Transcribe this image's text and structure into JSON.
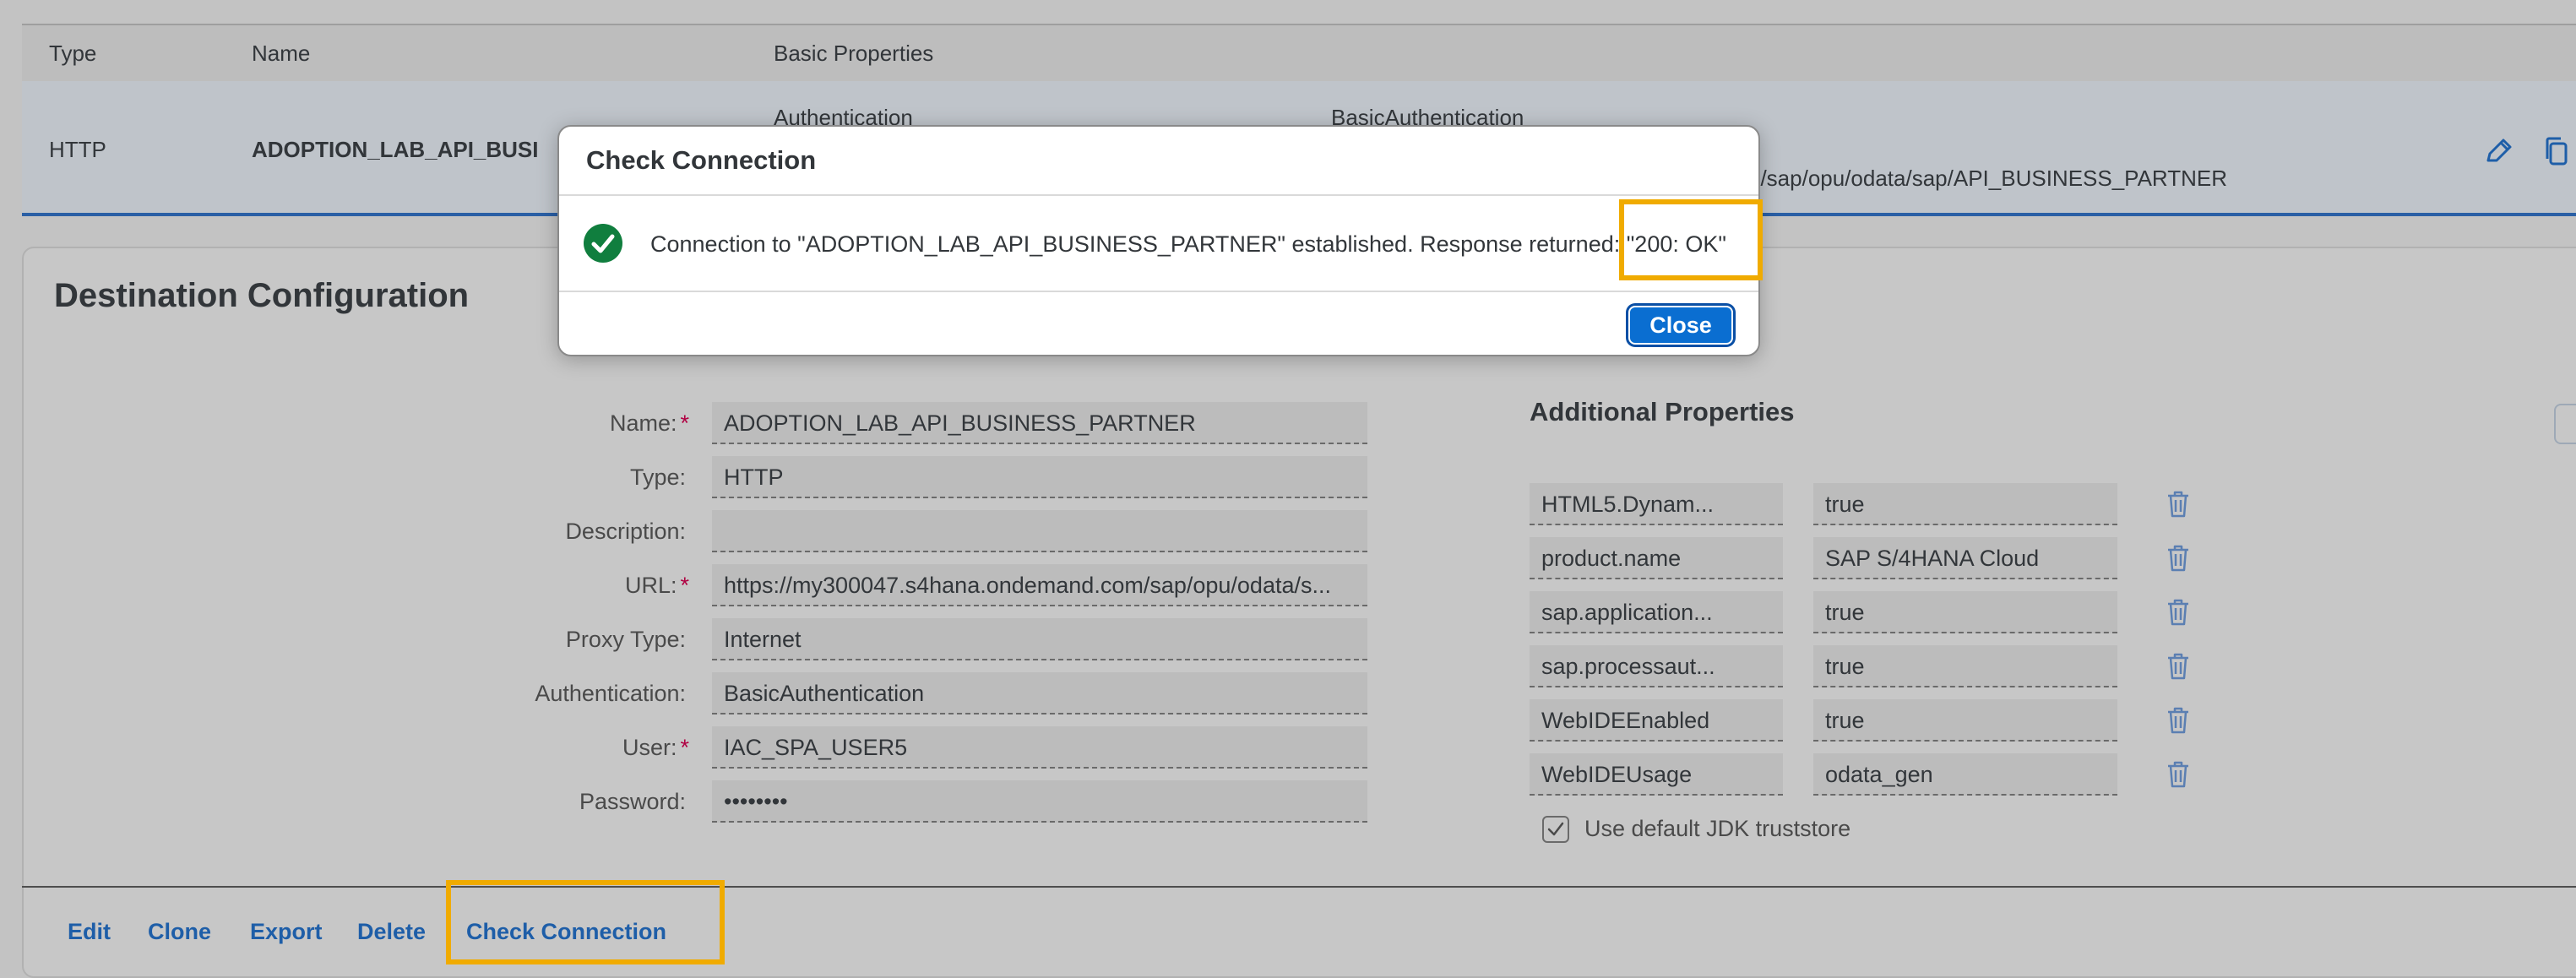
{
  "table": {
    "headers": {
      "type": "Type",
      "name": "Name",
      "basic_properties": "Basic Properties"
    },
    "row": {
      "type": "HTTP",
      "name": "ADOPTION_LAB_API_BUSI",
      "prop_label": "Authentication",
      "prop_value": "BasicAuthentication",
      "url_fragment": "n/sap/opu/odata/sap/API_BUSINESS_PARTNER"
    }
  },
  "dialog": {
    "title": "Check Connection",
    "message": "Connection to \"ADOPTION_LAB_API_BUSINESS_PARTNER\" established. Response returned: \"200: OK\"",
    "close_label": "Close"
  },
  "config": {
    "title": "Destination Configuration",
    "fields": [
      {
        "label": "Name:",
        "required": "*",
        "value": "ADOPTION_LAB_API_BUSINESS_PARTNER"
      },
      {
        "label": "Type:",
        "required": "",
        "value": "HTTP"
      },
      {
        "label": "Description:",
        "required": "",
        "value": ""
      },
      {
        "label": "URL:",
        "required": "*",
        "value": "https://my300047.s4hana.ondemand.com/sap/opu/odata/s..."
      },
      {
        "label": "Proxy Type:",
        "required": "",
        "value": "Internet"
      },
      {
        "label": "Authentication:",
        "required": "",
        "value": "BasicAuthentication"
      },
      {
        "label": "User:",
        "required": "*",
        "value": "IAC_SPA_USER5"
      },
      {
        "label": "Password:",
        "required": "",
        "value": "••••••••"
      }
    ],
    "additional_properties": {
      "title": "Additional Properties",
      "items": [
        {
          "key": "HTML5.Dynam...",
          "value": "true"
        },
        {
          "key": "product.name",
          "value": "SAP S/4HANA Cloud"
        },
        {
          "key": "sap.application...",
          "value": "true"
        },
        {
          "key": "sap.processaut...",
          "value": "true"
        },
        {
          "key": "WebIDEEnabled",
          "value": "true"
        },
        {
          "key": "WebIDEUsage",
          "value": "odata_gen"
        }
      ]
    },
    "truststore_label": "Use default JDK truststore",
    "truststore_checked": true
  },
  "footer": {
    "edit": "Edit",
    "clone": "Clone",
    "export": "Export",
    "delete": "Delete",
    "check_connection": "Check Connection"
  },
  "colors": {
    "accent": "#0a6ed1",
    "link": "#1e5ea8",
    "highlight": "#f0ab00",
    "success": "#107e3e",
    "required": "#b00042"
  },
  "icons": {
    "row_edit": "pencil-icon",
    "row_copy": "copy-icon",
    "success": "check-circle-icon",
    "delete": "trash-icon",
    "checkbox": "checkbox-checked-icon"
  }
}
